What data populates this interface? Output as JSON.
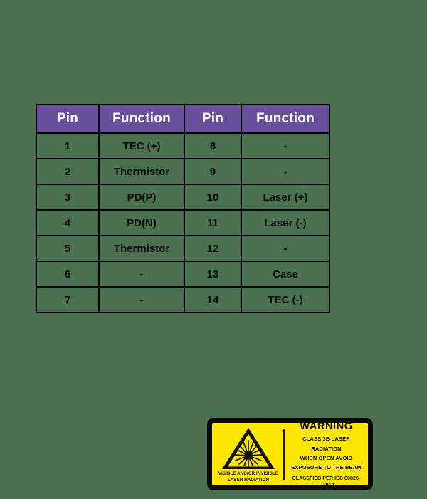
{
  "page": {
    "background_color": "#4a7150"
  },
  "pin_table": {
    "header_color": "#69509c",
    "header_text_color": "#ffffff",
    "border_color": "#000000",
    "columns": [
      "Pin",
      "Function",
      "Pin",
      "Function"
    ],
    "rows": [
      [
        "1",
        "TEC (+)",
        "8",
        "-"
      ],
      [
        "2",
        "Thermistor",
        "9",
        "-"
      ],
      [
        "3",
        "PD(P)",
        "10",
        "Laser (+)"
      ],
      [
        "4",
        "PD(N)",
        "11",
        "Laser (-)"
      ],
      [
        "5",
        "Thermistor",
        "12",
        "-"
      ],
      [
        "6",
        "-",
        "13",
        "Case"
      ],
      [
        "7",
        "-",
        "14",
        "TEC (-)"
      ]
    ]
  },
  "laser_warning_label": {
    "background_color": "#ffe600",
    "border_color": "#0a0a0a",
    "symbol_caption_line1": "VISIBLE AND/OR INVISIBLE",
    "symbol_caption_line2": "LASER RADIATION",
    "title": "WARNING",
    "line1": "CLASS 3B LASER RADIATION",
    "line2": "WHEN OPEN AVOID",
    "line3": "EXPOSURE TO THE BEAM",
    "standard": "CLASSFIED PER IEC 60825-1:2014"
  }
}
